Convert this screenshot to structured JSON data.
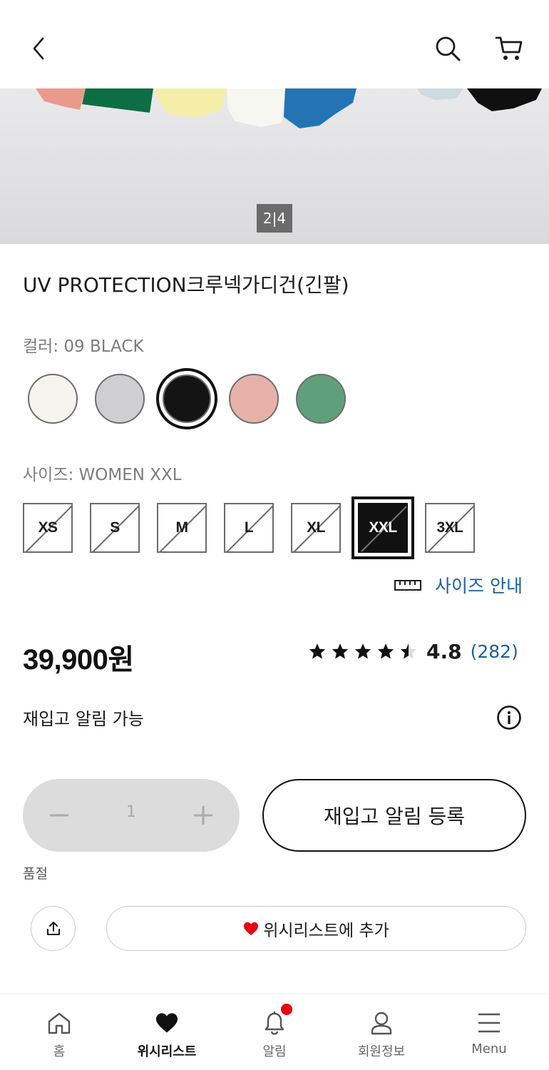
{
  "header": {
    "back_icon": "chevron-left-icon",
    "search_icon": "search-icon",
    "cart_icon": "cart-icon"
  },
  "gallery": {
    "pager_current": "2",
    "pager_total": "4",
    "pager_text": "2|4"
  },
  "product": {
    "title": "UV PROTECTION크루넥가디건(긴팔)",
    "color_label": "컬러: 09 BLACK",
    "colors": [
      {
        "name": "white",
        "hex": "#f5f4ef",
        "selected": false
      },
      {
        "name": "gray",
        "hex": "#cfcfd1",
        "selected": false
      },
      {
        "name": "black",
        "hex": "#141414",
        "selected": true
      },
      {
        "name": "pink",
        "hex": "#e6b1a8",
        "selected": false
      },
      {
        "name": "green",
        "hex": "#5f9f7c",
        "selected": false
      }
    ],
    "size_label": "사이즈: WOMEN XXL",
    "sizes": [
      {
        "label": "XS",
        "unavailable": true,
        "selected": false
      },
      {
        "label": "S",
        "unavailable": true,
        "selected": false
      },
      {
        "label": "M",
        "unavailable": true,
        "selected": false
      },
      {
        "label": "L",
        "unavailable": true,
        "selected": false
      },
      {
        "label": "XL",
        "unavailable": true,
        "selected": false
      },
      {
        "label": "XXL",
        "unavailable": true,
        "selected": true
      },
      {
        "label": "3XL",
        "unavailable": true,
        "selected": false
      }
    ],
    "size_guide_label": "사이즈 안내",
    "size_guide_icon": "ruler-icon",
    "price": "39,900원",
    "rating_value": "4.8",
    "rating_stars": 4.5,
    "review_count": "(282)",
    "restock_text": "재입고 알림 가능",
    "info_icon": "info-icon"
  },
  "purchase": {
    "quantity": "1",
    "restock_button": "재입고 알림 등록",
    "soldout_label": "품절",
    "wishlist_button": "위시리스트에 추가",
    "share_icon": "share-icon"
  },
  "bottom_nav": {
    "items": [
      {
        "label": "홈",
        "icon": "home-icon",
        "active": false
      },
      {
        "label": "위시리스트",
        "icon": "heart-icon",
        "active": true
      },
      {
        "label": "알림",
        "icon": "bell-icon",
        "active": false,
        "badge": true
      },
      {
        "label": "회원정보",
        "icon": "user-icon",
        "active": false
      },
      {
        "label": "Menu",
        "icon": "menu-icon",
        "active": false
      }
    ]
  },
  "colors": {
    "accent_link": "#1b5fa8",
    "heart_red": "#e60012",
    "disabled_gray": "#dcdcdc"
  }
}
